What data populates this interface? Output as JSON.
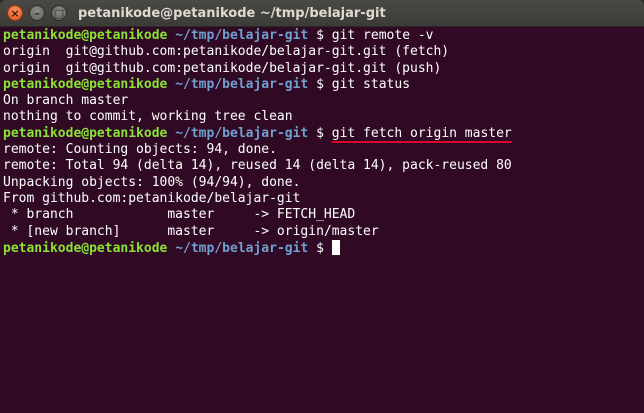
{
  "window": {
    "title": "petanikode@petanikode ~/tmp/belajar-git",
    "close_glyph": "×",
    "minimize_glyph": "–",
    "maximize_glyph": "□"
  },
  "prompt": {
    "user": "petanikode@petanikode",
    "path": "~/tmp/belajar-git",
    "symbol": "$"
  },
  "colors": {
    "background": "#300a24",
    "user": "#8ae234",
    "path": "#729fcf",
    "text": "#ffffff",
    "underline": "#d9002d"
  },
  "lines": [
    {
      "type": "prompt",
      "cmd": "git remote -v"
    },
    {
      "type": "output",
      "text": "origin  git@github.com:petanikode/belajar-git.git (fetch)"
    },
    {
      "type": "output",
      "text": "origin  git@github.com:petanikode/belajar-git.git (push)"
    },
    {
      "type": "prompt",
      "cmd": "git status"
    },
    {
      "type": "output",
      "text": "On branch master"
    },
    {
      "type": "output",
      "text": "nothing to commit, working tree clean"
    },
    {
      "type": "prompt",
      "cmd": "git fetch origin master",
      "highlight": true
    },
    {
      "type": "output",
      "text": "remote: Counting objects: 94, done."
    },
    {
      "type": "output",
      "text": "remote: Total 94 (delta 14), reused 14 (delta 14), pack-reused 80"
    },
    {
      "type": "output",
      "text": "Unpacking objects: 100% (94/94), done."
    },
    {
      "type": "output",
      "text": "From github.com:petanikode/belajar-git"
    },
    {
      "type": "output",
      "text": " * branch            master     -> FETCH_HEAD"
    },
    {
      "type": "output",
      "text": " * [new branch]      master     -> origin/master"
    },
    {
      "type": "prompt",
      "cmd": "",
      "cursor": true
    }
  ]
}
